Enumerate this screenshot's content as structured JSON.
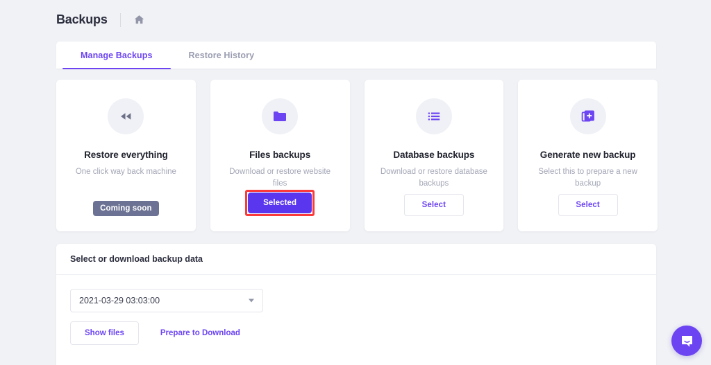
{
  "header": {
    "title": "Backups",
    "home_icon": "home-icon"
  },
  "tabs": [
    {
      "label": "Manage Backups",
      "active": true
    },
    {
      "label": "Restore History",
      "active": false
    }
  ],
  "cards": [
    {
      "icon": "rewind-icon",
      "title": "Restore everything",
      "desc": "One click way back machine",
      "action_type": "badge",
      "action_label": "Coming soon"
    },
    {
      "icon": "folder-icon",
      "title": "Files backups",
      "desc": "Download or restore website files",
      "action_type": "primary",
      "action_label": "Selected",
      "highlight_color": "#fb3b3b"
    },
    {
      "icon": "list-icon",
      "title": "Database backups",
      "desc": "Download or restore database backups",
      "action_type": "outline",
      "action_label": "Select"
    },
    {
      "icon": "add-document-icon",
      "title": "Generate new backup",
      "desc": "Select this to prepare a new backup",
      "action_type": "outline",
      "action_label": "Select"
    }
  ],
  "panel": {
    "heading": "Select or download backup data",
    "backup_select_value": "2021-03-29 03:03:00",
    "show_files_label": "Show files",
    "prepare_download_label": "Prepare to Download"
  },
  "chat": {
    "icon": "chat-bubble-icon"
  },
  "colors": {
    "accent": "#6c44f2",
    "primary_button": "#5b36ef",
    "badge_gray": "#6c7293",
    "highlight_red": "#fb3b3b",
    "page_background": "#f1f2f6"
  }
}
